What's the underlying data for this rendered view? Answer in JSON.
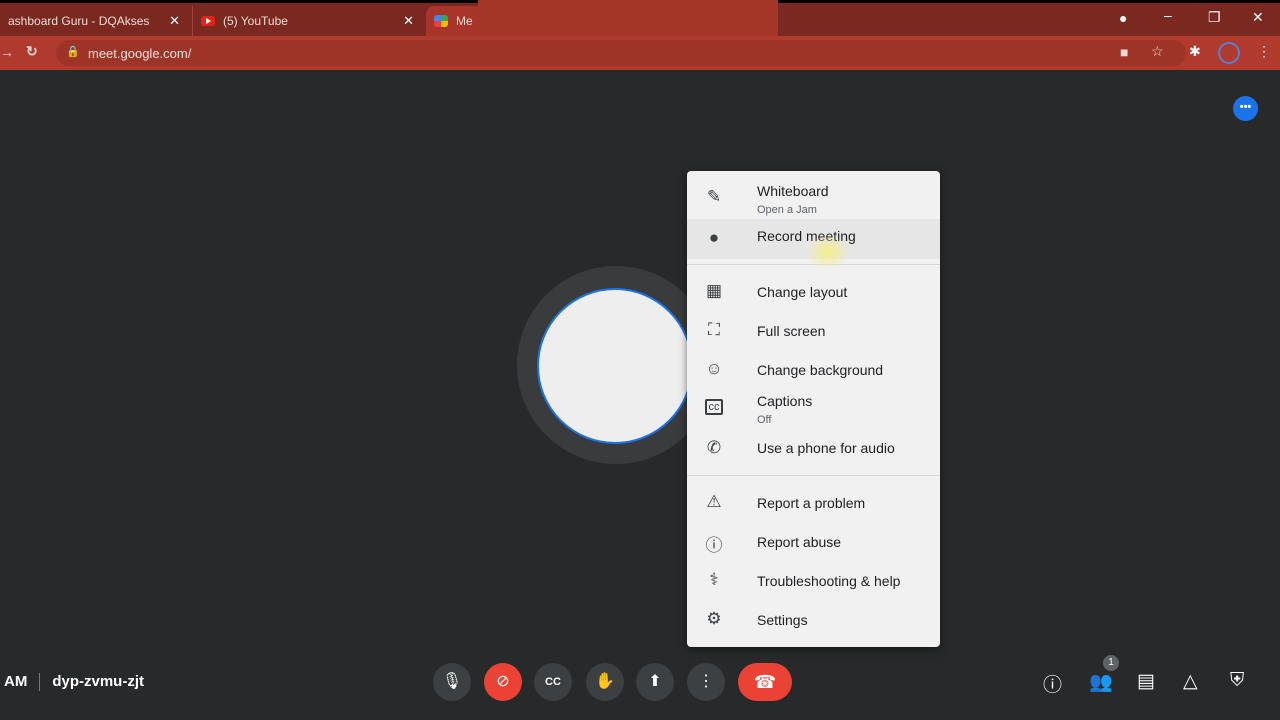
{
  "browser": {
    "tabs": [
      {
        "label": "ashboard Guru - DQAkses"
      },
      {
        "label": "(5) YouTube"
      },
      {
        "label": "Me"
      }
    ],
    "url": "meet.google.com/"
  },
  "menu": {
    "items": [
      {
        "label": "Whiteboard",
        "sub": "Open a Jam",
        "icon": "pencil-icon"
      },
      {
        "label": "Record meeting",
        "icon": "record-icon"
      },
      {
        "label": "Change layout",
        "icon": "layout-icon"
      },
      {
        "label": "Full screen",
        "icon": "fullscreen-icon"
      },
      {
        "label": "Change background",
        "icon": "background-icon"
      },
      {
        "label": "Captions",
        "sub": "Off",
        "icon": "captions-icon"
      },
      {
        "label": "Use a phone for audio",
        "icon": "phone-icon"
      },
      {
        "label": "Report a problem",
        "icon": "report-problem-icon"
      },
      {
        "label": "Report abuse",
        "icon": "report-abuse-icon"
      },
      {
        "label": "Troubleshooting & help",
        "icon": "troubleshooting-icon"
      },
      {
        "label": "Settings",
        "icon": "gear-icon"
      }
    ]
  },
  "footer": {
    "time": "AM",
    "meeting_code": "dyp-zvmu-zjt",
    "participants_count": "1"
  },
  "colors": {
    "accent": "#1a73e8",
    "danger": "#ea4335",
    "browser_theme": "#b03a2e"
  }
}
